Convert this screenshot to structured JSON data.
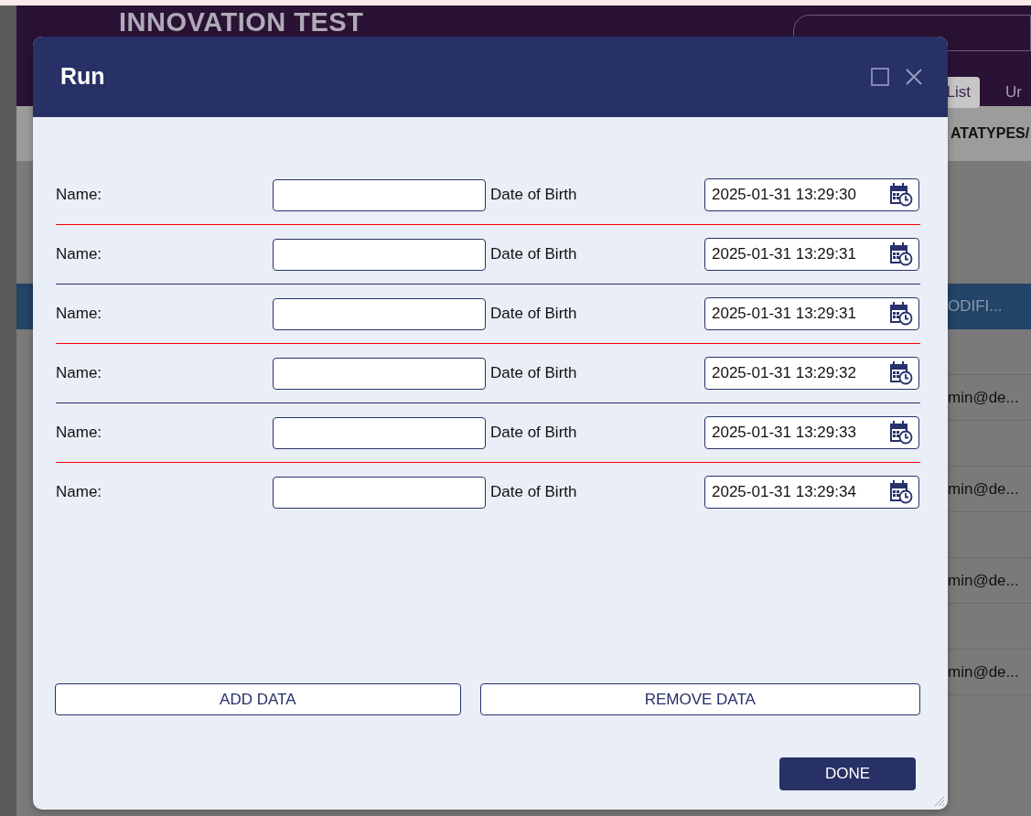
{
  "background": {
    "app_title": "INNOVATION TEST",
    "nav_tabs": [
      {
        "label": "List",
        "selected": true
      },
      {
        "label": "Ur",
        "selected": false
      }
    ],
    "breadcrumb": "ATATYPES/",
    "table": {
      "header": "ODIFI...",
      "cells": [
        "min@de...",
        "min@de...",
        "min@de...",
        "min@de..."
      ]
    }
  },
  "dialog": {
    "title": "Run",
    "rows": [
      {
        "name_label": "Name:",
        "date_label": "Date of Birth",
        "date_value": "2025-01-31 13:29:30",
        "divider": {
          "color": "#ff0000"
        }
      },
      {
        "name_label": "Name:",
        "date_label": "Date of Birth",
        "date_value": "2025-01-31 13:29:31",
        "divider": {
          "color": "#27316b"
        }
      },
      {
        "name_label": "Name:",
        "date_label": "Date of Birth",
        "date_value": "2025-01-31 13:29:31",
        "divider": {
          "color": "#ff0000"
        }
      },
      {
        "name_label": "Name:",
        "date_label": "Date of Birth",
        "date_value": "2025-01-31 13:29:32",
        "divider": {
          "color": "#27316b"
        }
      },
      {
        "name_label": "Name:",
        "date_label": "Date of Birth",
        "date_value": "2025-01-31 13:29:33",
        "divider": {
          "color": "#ff0000"
        }
      },
      {
        "name_label": "Name:",
        "date_label": "Date of Birth",
        "date_value": "2025-01-31 13:29:34"
      }
    ],
    "add_button": "ADD DATA",
    "remove_button": "REMOVE DATA",
    "done_button": "DONE"
  }
}
